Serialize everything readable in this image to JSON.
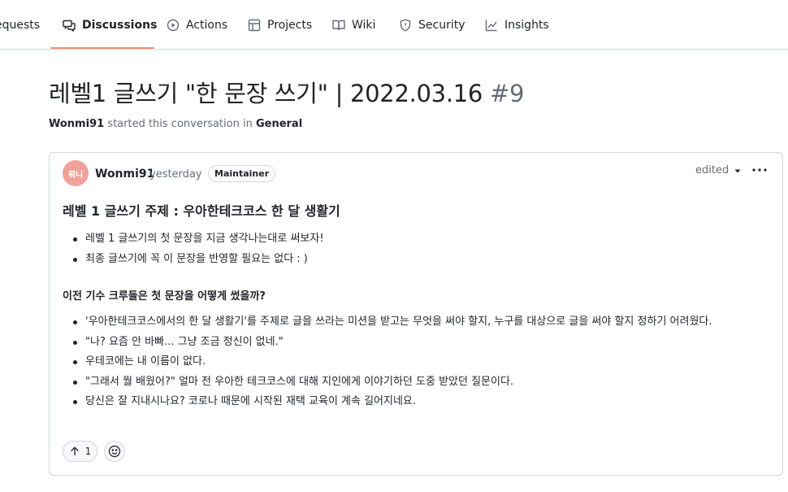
{
  "nav": {
    "items": [
      {
        "label": "equests",
        "icon": "pull-request-icon"
      },
      {
        "label": "Discussions",
        "icon": "comment-discussion-icon",
        "active": true
      },
      {
        "label": "Actions",
        "icon": "play-icon"
      },
      {
        "label": "Projects",
        "icon": "table-icon"
      },
      {
        "label": "Wiki",
        "icon": "book-icon"
      },
      {
        "label": "Security",
        "icon": "shield-icon"
      },
      {
        "label": "Insights",
        "icon": "graph-icon"
      }
    ],
    "active_color": "#fd8c73"
  },
  "header": {
    "title": "레벨1 글쓰기 \"한 문장 쓰기\" | 2022.03.16",
    "number": "#9",
    "author": "Wonmi91",
    "started_text": "started this conversation in",
    "category": "General"
  },
  "post": {
    "avatar_text": "워니",
    "author": "Wonmi91",
    "time": "yesterday",
    "badge": "Maintainer",
    "edited_label": "edited",
    "heading": "레벨 1 글쓰기 주제 : 우아한테크코스 한 달 생활기",
    "list1": [
      "레벨 1 글쓰기의 첫 문장을 지금 생각나는대로 써보자!",
      "최종 글쓰기에 꼭 이 문장을 반영할 필요는 없다 : )"
    ],
    "subheading": "이전 기수 크루들은 첫 문장을 어떻게 썼을까?",
    "list2": [
      "'우아한테크코스에서의 한 달 생활기'를 주제로 글을 쓰라는 미션을 받고는 무엇을 써야 할지, 누구를 대상으로 글을 써야 할지 정하기 어려웠다.",
      "\"나? 요즘 안 바빠... 그냥 조금 정신이 없네.\"",
      "우테코에는 내 이름이 없다.",
      "\"그래서 뭘 배웠어?\" 얼마 전 우아한 테크코스에 대해 지인에게 이야기하던 도중 받았던 질문이다.",
      "당신은 잘 지내시나요? 코로나 때문에 시작된 재택 교육이 계속 길어지네요."
    ],
    "reaction_count": "1"
  }
}
